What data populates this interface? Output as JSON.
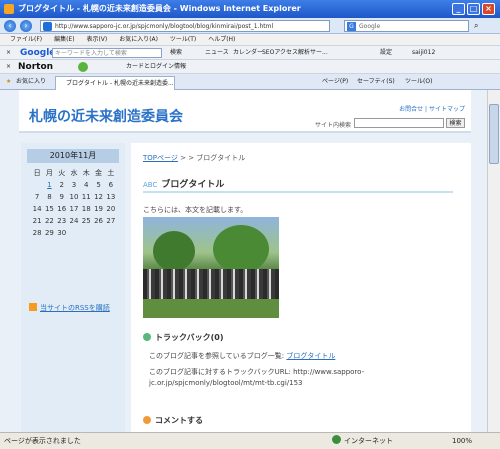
{
  "window": {
    "title": "ブログタイトル ‐ 札幌の近未来創造委員会 - Windows Internet Explorer"
  },
  "address": {
    "url": "http://www.sapporo-jc.or.jp/spjcmonly/blogtool/blog/kinmirai/post_1.html",
    "search_placeholder": "Google"
  },
  "menu": [
    "ファイル(F)",
    "編集(E)",
    "表示(V)",
    "お気に入り(A)",
    "ツール(T)",
    "ヘルプ(H)"
  ],
  "google_bar": {
    "logo": "Google",
    "placeholder": "キーワードを入力して検索",
    "search_label": "検索",
    "news": "ニュース",
    "calendar": "カレンダー",
    "site": "SEOアクセス解析サー...",
    "settings": "設定",
    "user": "saiji012"
  },
  "norton_bar": {
    "logo": "Norton",
    "card": "カードとログイン情報"
  },
  "tabbar": {
    "favorites": "お気に入り",
    "tab_title": "ブログタイトル ‐ 札幌の近未来創造委...",
    "page": "ページ(P)",
    "safety": "セーフティ(S)",
    "tools": "ツール(O)"
  },
  "site": {
    "title": "札幌の近未来創造委員会",
    "contact": "お問合せ",
    "sitemap": "サイトマップ",
    "search_label": "サイト内検索",
    "search_button": "検索"
  },
  "calendar": {
    "month": "2010年11月",
    "weekdays": [
      "日",
      "月",
      "火",
      "水",
      "木",
      "金",
      "土"
    ],
    "rows": [
      [
        "",
        "1",
        "2",
        "3",
        "4",
        "5",
        "6"
      ],
      [
        "7",
        "8",
        "9",
        "10",
        "11",
        "12",
        "13"
      ],
      [
        "14",
        "15",
        "16",
        "17",
        "18",
        "19",
        "20"
      ],
      [
        "21",
        "22",
        "23",
        "24",
        "25",
        "26",
        "27"
      ],
      [
        "28",
        "29",
        "30",
        "",
        "",
        "",
        ""
      ]
    ]
  },
  "sidebar": {
    "rss": "当サイトのRSSを購読"
  },
  "main": {
    "crumb_top": "TOPページ",
    "crumb_rest": " > > ブログタイトル",
    "post_title": "ブログタイトル",
    "post_tag": "ABC",
    "body": "こちらには、本文を記載します。",
    "trackback_heading": "トラックバック(0)",
    "trackback_text": "このブログ記事を参照しているブログ一覧: ",
    "trackback_link": "ブログタイトル",
    "trackback_url": "このブログ記事に対するトラックバックURL: http://www.sapporo-jc.or.jp/spjcmonly/blogtool/mt/mt-tb.cgi/153",
    "comment_heading": "コメントする"
  },
  "status": {
    "text": "ページが表示されました",
    "zone": "インターネット",
    "zoom": "100%"
  },
  "colors": {
    "accent": "#2a72c8",
    "link": "#2a6fbf",
    "trackback_star": "#5ab87a",
    "comment_star": "#f19a3b"
  }
}
